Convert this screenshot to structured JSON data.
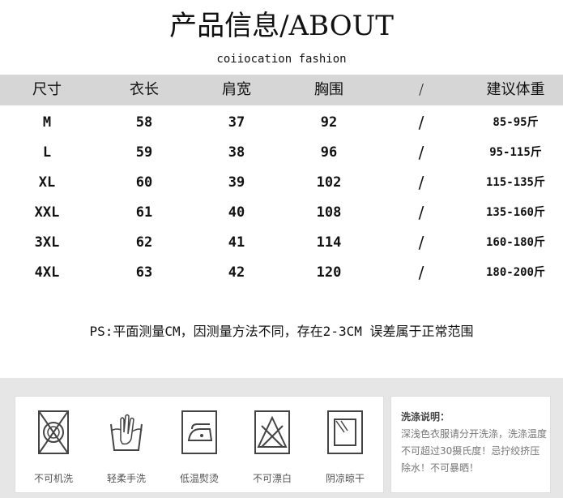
{
  "title": "产品信息/ABOUT",
  "subtitle": "coiiocation fashion",
  "table": {
    "headers": [
      "尺寸",
      "衣长",
      "肩宽",
      "胸围",
      "/",
      "建议体重"
    ],
    "rows": [
      [
        "M",
        "58",
        "37",
        "92",
        "/",
        "85-95斤"
      ],
      [
        "L",
        "59",
        "38",
        "96",
        "/",
        "95-115斤"
      ],
      [
        "XL",
        "60",
        "39",
        "102",
        "/",
        "115-135斤"
      ],
      [
        "XXL",
        "61",
        "40",
        "108",
        "/",
        "135-160斤"
      ],
      [
        "3XL",
        "62",
        "41",
        "114",
        "/",
        "160-180斤"
      ],
      [
        "4XL",
        "63",
        "42",
        "120",
        "/",
        "180-200斤"
      ]
    ]
  },
  "note": "PS:平面测量CM，因测量方法不同，存在2-3CM 误差属于正常范围",
  "care": {
    "icons": [
      {
        "icon": "no-machine-wash-icon",
        "label": "不可机洗"
      },
      {
        "icon": "gentle-hand-wash-icon",
        "label": "轻柔手洗"
      },
      {
        "icon": "low-iron-icon",
        "label": "低温熨烫"
      },
      {
        "icon": "no-bleach-icon",
        "label": "不可漂白"
      },
      {
        "icon": "dry-in-shade-icon",
        "label": "阴凉晾干"
      }
    ],
    "instructions_title": "洗涤说明：",
    "instructions_text": "深浅色衣服请分开洗涤，洗涤温度不可超过30摄氏度！忌拧绞挤压除水！不可暴晒！"
  },
  "colors": {
    "header_band": "#d6d6d6",
    "care_background": "#e6e6e6"
  }
}
